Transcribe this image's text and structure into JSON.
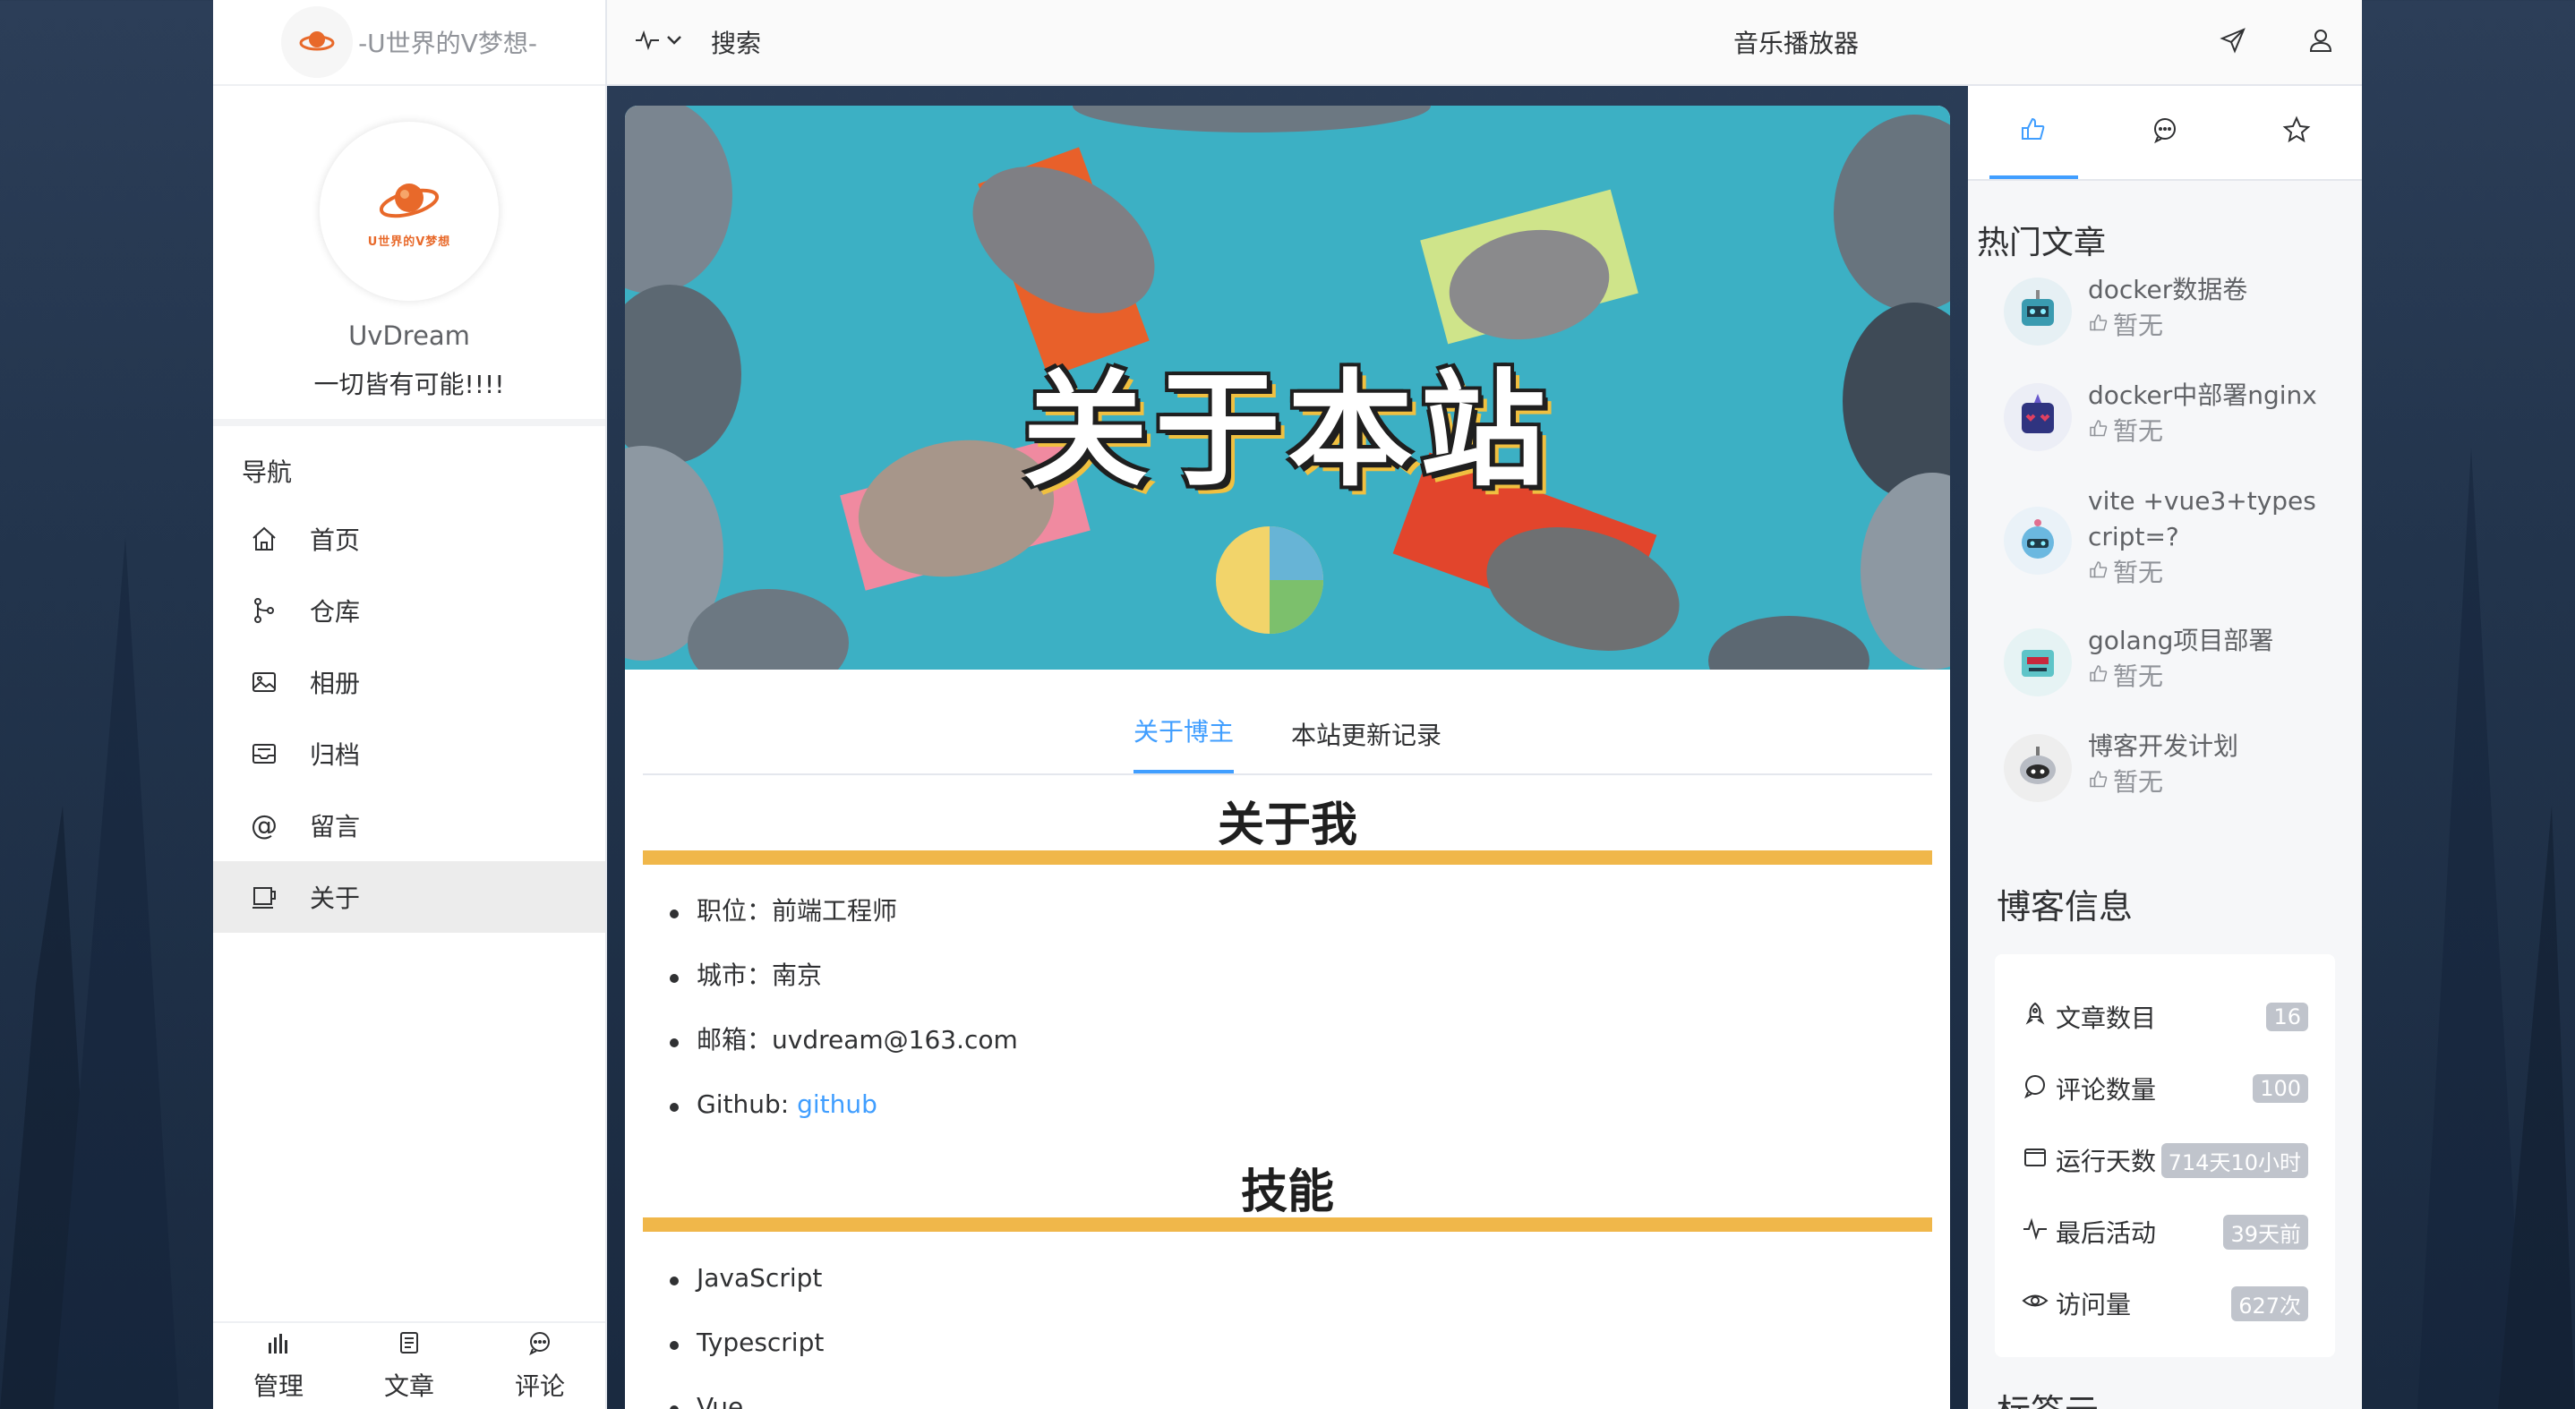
{
  "brand": {
    "title": "-U世界的V梦想-",
    "logo_text": "U世界的V梦想"
  },
  "profile": {
    "name": "UvDream",
    "motto": "一切皆有可能!!!!"
  },
  "nav": {
    "title": "导航",
    "items": [
      {
        "label": "首页",
        "icon": "home-icon"
      },
      {
        "label": "仓库",
        "icon": "branch-icon"
      },
      {
        "label": "相册",
        "icon": "picture-icon"
      },
      {
        "label": "归档",
        "icon": "inbox-icon"
      },
      {
        "label": "留言",
        "icon": "at-icon"
      },
      {
        "label": "关于",
        "icon": "cup-icon",
        "active": true
      }
    ]
  },
  "bottom_bar": [
    {
      "label": "管理",
      "icon": "chart-icon"
    },
    {
      "label": "文章",
      "icon": "document-icon"
    },
    {
      "label": "评论",
      "icon": "comment-icon"
    }
  ],
  "header": {
    "search_label": "搜索",
    "music_label": "音乐播放器"
  },
  "banner": {
    "title": "关于本站"
  },
  "tabs": [
    {
      "label": "关于博主",
      "active": true
    },
    {
      "label": "本站更新记录",
      "active": false
    }
  ],
  "about": {
    "title": "关于我",
    "items": [
      {
        "text": "职位：前端工程师"
      },
      {
        "text": "城市：南京"
      },
      {
        "text": "邮箱：uvdream@163.com"
      },
      {
        "text": "Github: ",
        "link": "github"
      }
    ]
  },
  "skills": {
    "title": "技能",
    "items": [
      "JavaScript",
      "Typescript",
      "Vue"
    ]
  },
  "right": {
    "hot_title": "热门文章",
    "hot_articles": [
      {
        "name": "docker数据卷",
        "likes": "暂无"
      },
      {
        "name": "docker中部署nginx",
        "likes": "暂无"
      },
      {
        "name": "vite +vue3+typescript=?",
        "likes": "暂无"
      },
      {
        "name": "golang项目部署",
        "likes": "暂无"
      },
      {
        "name": "博客开发计划",
        "likes": "暂无"
      }
    ],
    "blog_info_title": "博客信息",
    "blog_info": [
      {
        "label": "文章数目",
        "value": "16",
        "icon": "rocket-icon"
      },
      {
        "label": "评论数量",
        "value": "100",
        "icon": "comment-icon"
      },
      {
        "label": "运行天数",
        "value": "714天10小时",
        "icon": "window-icon"
      },
      {
        "label": "最后活动",
        "value": "39天前",
        "icon": "pulse-icon"
      },
      {
        "label": "访问量",
        "value": "627次",
        "icon": "eye-icon"
      }
    ],
    "tags_title": "标签云"
  },
  "colors": {
    "accent": "#409eff",
    "heading_bar": "#f0b74a",
    "banner_bg": "#3cb0c4"
  }
}
